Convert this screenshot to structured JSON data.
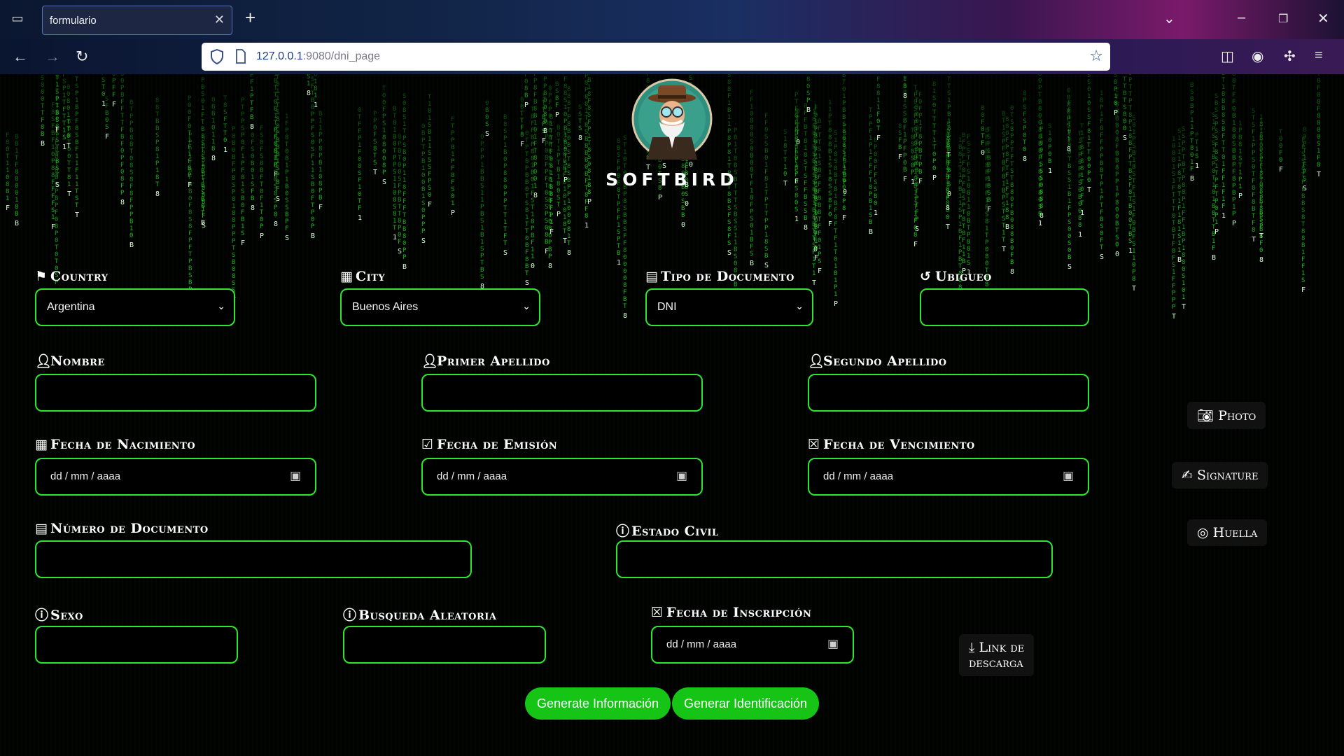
{
  "browser": {
    "tab_title": "formulario",
    "url_host": "127.0.0.1",
    "url_path": ":9080/dni_page"
  },
  "brand": {
    "name": "SOFTBIRD"
  },
  "form": {
    "country": {
      "label": "Country",
      "value": "Argentina"
    },
    "city": {
      "label": "City",
      "value": "Buenos Aires"
    },
    "tipo_documento": {
      "label": "Tipo de Documento",
      "value": "DNI"
    },
    "ubigueo": {
      "label": "Ubigueo",
      "value": ""
    },
    "nombre": {
      "label": "Nombre",
      "value": ""
    },
    "primer_apellido": {
      "label": "Primer Apellido",
      "value": ""
    },
    "segundo_apellido": {
      "label": "Segundo Apellido",
      "value": ""
    },
    "fecha_nacimiento": {
      "label": "Fecha de Nacimiento",
      "placeholder": "dd / mm / aaaa"
    },
    "fecha_emision": {
      "label": "Fecha de Emisión",
      "placeholder": "dd / mm / aaaa"
    },
    "fecha_vencimiento": {
      "label": "Fecha de Vencimiento",
      "placeholder": "dd / mm / aaaa"
    },
    "numero_documento": {
      "label": "Número de Documento",
      "value": ""
    },
    "estado_civil": {
      "label": "Estado Civil",
      "value": ""
    },
    "sexo": {
      "label": "Sexo",
      "value": ""
    },
    "busqueda_aleatoria": {
      "label": "Busqueda Aleatoria",
      "value": ""
    },
    "fecha_inscripcion": {
      "label": "Fecha de Inscripción",
      "placeholder": "dd / mm / aaaa"
    }
  },
  "side": {
    "photo": "Photo",
    "signature": "Signature",
    "huella": "Huella",
    "link_line1": "Link de",
    "link_line2": "descarga"
  },
  "buttons": {
    "generate_info": "Generate Información",
    "generate_id": "Generar Identificación"
  },
  "colors": {
    "accent": "#2ee62e",
    "button": "#16c416",
    "rain": "#22d622"
  },
  "rain_glyphs": [
    "B",
    "F",
    "T",
    "S",
    "0",
    "8",
    "1",
    "P"
  ]
}
